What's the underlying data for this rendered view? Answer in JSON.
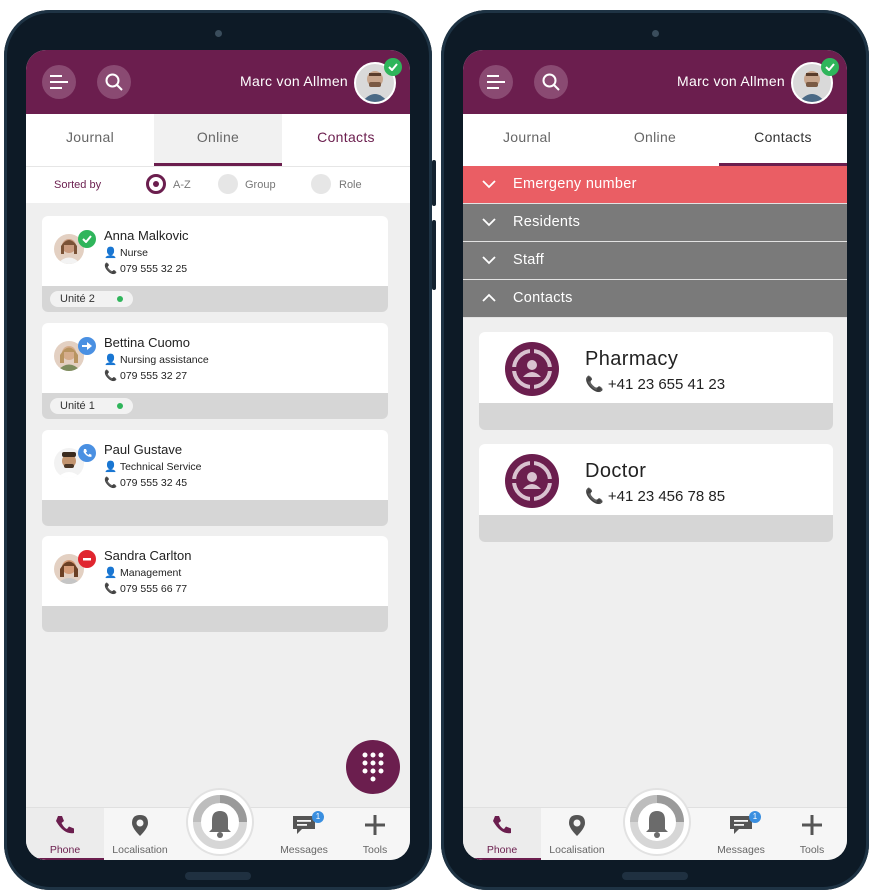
{
  "user": {
    "name": "Marc von Allmen",
    "status": "online"
  },
  "colors": {
    "brand": "#6b1e4e",
    "online": "#2fb55b",
    "emergency": "#ea5e64",
    "section": "#7a7a7a",
    "transfer": "#4a90e2",
    "busy": "#e0262f"
  },
  "tabs": [
    "Journal",
    "Online",
    "Contacts"
  ],
  "sort": {
    "label": "Sorted by",
    "options": [
      "A-Z",
      "Group",
      "Role"
    ],
    "selected": "A-Z"
  },
  "online_list": [
    {
      "name": "Anna Malkovic",
      "role": "Nurse",
      "phone": "079 555 32 25",
      "unit": "Unité 2",
      "status_icon": "check-icon"
    },
    {
      "name": "Bettina Cuomo",
      "role": "Nursing assistance",
      "phone": "079 555 32 27",
      "unit": "Unité 1",
      "status_icon": "forward-arrow-icon"
    },
    {
      "name": "Paul Gustave",
      "role": "Technical Service",
      "phone": "079 555 32 45",
      "unit": "",
      "status_icon": "phone-call-icon"
    },
    {
      "name": "Sandra Carlton",
      "role": "Management",
      "phone": "079 555 66 77",
      "unit": "",
      "status_icon": "do-not-disturb-icon"
    }
  ],
  "sections": [
    {
      "label": "Emergeny number",
      "expanded": false
    },
    {
      "label": "Residents",
      "expanded": false
    },
    {
      "label": "Staff",
      "expanded": false
    },
    {
      "label": "Contacts",
      "expanded": true
    }
  ],
  "contacts": [
    {
      "name": "Pharmacy",
      "phone": "+41 23 655 41 23"
    },
    {
      "name": "Doctor",
      "phone": "+41 23 456 78 85"
    }
  ],
  "bottom_nav": {
    "phone": "Phone",
    "localisation": "Localisation",
    "messages": "Messages",
    "tools": "Tools",
    "messages_badge": "1"
  },
  "icons": {
    "menu": "menu-icon",
    "search": "search-icon",
    "dialpad": "dialpad-icon",
    "alarm": "bell-alarm-icon"
  }
}
